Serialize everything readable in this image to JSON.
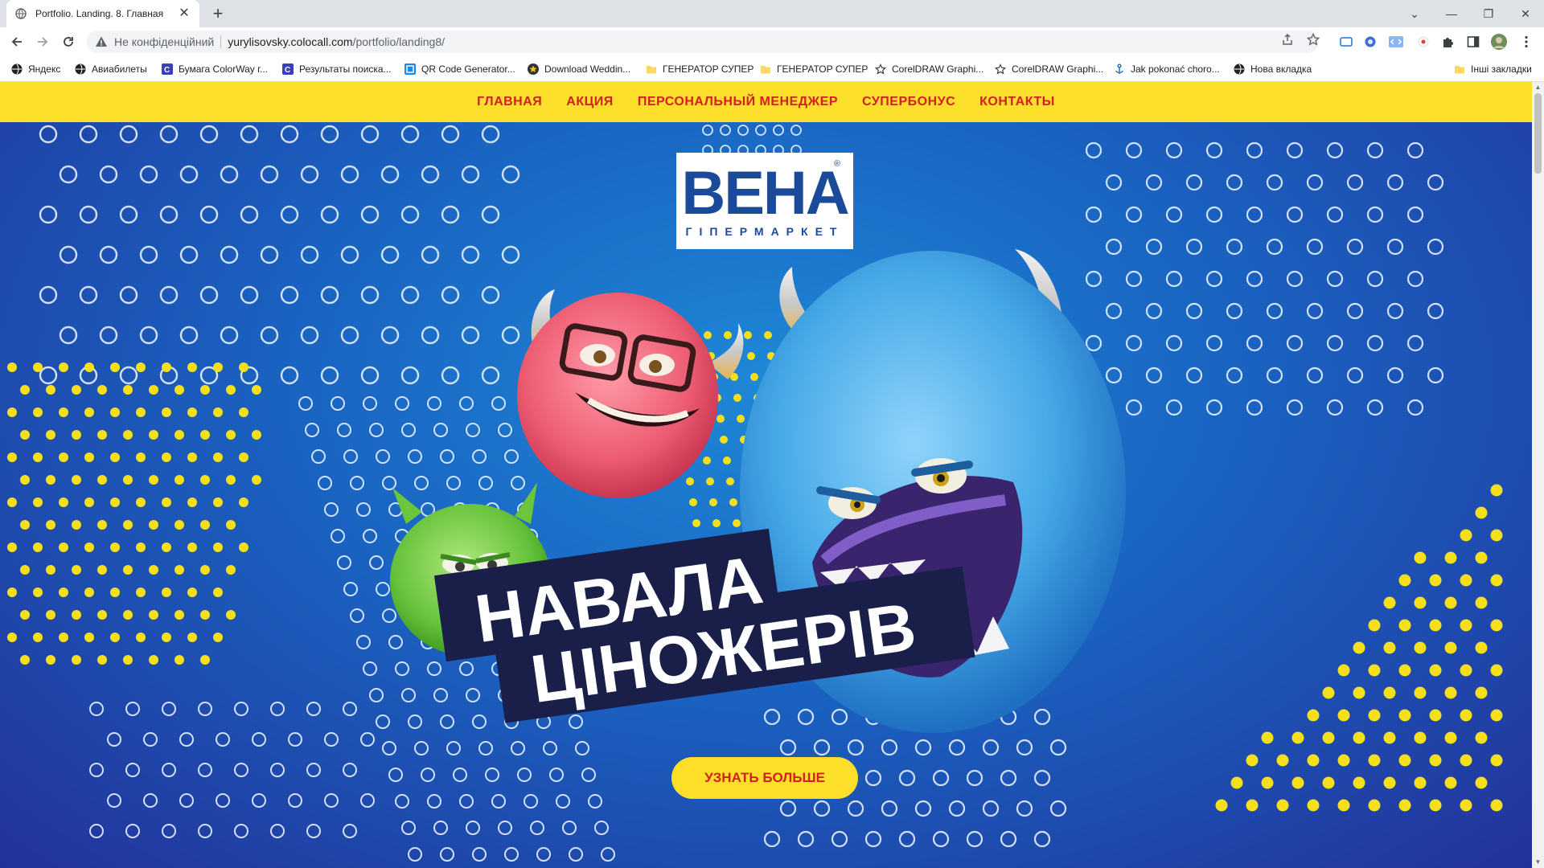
{
  "browser": {
    "tab_title": "Portfolio. Landing. 8. Главная",
    "tab_close": "✕",
    "new_tab": "+",
    "security_label": "Не конфіденційний",
    "url_host": "yurylisovsky.colocall.com",
    "url_path": "/portfolio/landing8/",
    "window_controls": [
      "⌄",
      "—",
      "❐",
      "✕"
    ],
    "bookmarks": [
      {
        "label": "Яндекс",
        "icon": "globe-icon"
      },
      {
        "label": "Авиабилеты",
        "icon": "globe-icon"
      },
      {
        "label": "Бумага ColorWay г...",
        "icon": "c-icon"
      },
      {
        "label": "Результаты поиска...",
        "icon": "c-icon"
      },
      {
        "label": "QR Code Generator...",
        "icon": "qr-icon"
      },
      {
        "label": "Download Weddin...",
        "icon": "star-badge-icon"
      },
      {
        "label": "ГЕНЕРАТОР СУПЕР",
        "icon": "folder-icon"
      },
      {
        "label": "ГЕНЕРАТОР СУПЕР",
        "icon": "folder-icon"
      },
      {
        "label": "CorelDRAW Graphi...",
        "icon": "star-icon"
      },
      {
        "label": "CorelDRAW Graphi...",
        "icon": "star-icon"
      },
      {
        "label": "Jak pokonać choro...",
        "icon": "anchor-icon"
      },
      {
        "label": "Нова вкладка",
        "icon": "globe-icon"
      }
    ],
    "other_bookmarks": "Інші закладки"
  },
  "site": {
    "nav": [
      "ГЛАВНАЯ",
      "АКЦИЯ",
      "ПЕРСОНАЛЬНЫЙ МЕНЕДЖЕР",
      "СУПЕРБОНУС",
      "КОНТАКТЫ"
    ],
    "logo_main": "ВЕНА",
    "logo_sub": "ГІПЕРМАРКЕТ",
    "logo_reg": "®",
    "headline_line1": "НАВАЛА",
    "headline_line2": "ЦІНОЖЕРІВ",
    "cta_label": "УЗНАТЬ БОЛЬШЕ"
  },
  "colors": {
    "nav_bg": "#fde02b",
    "nav_text": "#d41f1f",
    "hero_blue": "#1a62c1",
    "hero_dark": "#23329a",
    "banner_dark": "#1a1f4a",
    "dot_yellow": "#f6e01c",
    "monster_blue": "#52b4ec",
    "monster_pink": "#ef5b72",
    "monster_green": "#6cc63c"
  }
}
